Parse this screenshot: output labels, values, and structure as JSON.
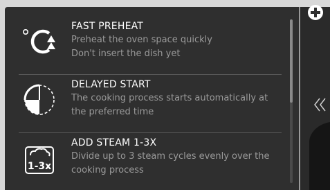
{
  "menu": {
    "items": [
      {
        "icon": "fast-preheat-icon",
        "title": "FAST PREHEAT",
        "desc1": "Preheat the oven space quickly",
        "desc2": "Don't insert the dish yet"
      },
      {
        "icon": "delayed-start-icon",
        "title": "DELAYED START",
        "desc1": "The cooking process starts automatically at",
        "desc2": "the preferred time"
      },
      {
        "icon": "add-steam-icon",
        "icon_text": "1-3x",
        "title": "ADD STEAM 1-3X",
        "desc1": "Divide up to 3 steam cycles evenly over the",
        "desc2": "cooking process"
      }
    ]
  },
  "side": {
    "add_icon": "plus-circle-icon",
    "collapse_icon": "double-chevron-left-icon"
  },
  "colors": {
    "background": "#2f2f2f",
    "title": "#ffffff",
    "description": "#9a9a9a"
  }
}
